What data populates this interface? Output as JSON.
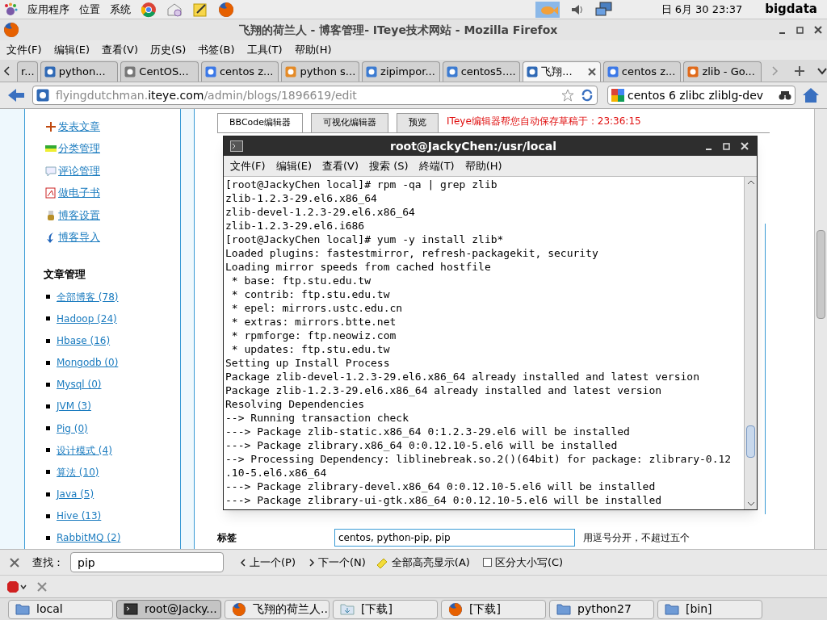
{
  "desktop_panel": {
    "menus": [
      "应用程序",
      "位置",
      "系统"
    ],
    "clock": "日 6月 30 23:37",
    "user": "bigdata"
  },
  "browser": {
    "title": "飞翔的荷兰人 - 博客管理- ITeye技术网站 - Mozilla Firefox",
    "menu": [
      "文件(F)",
      "编辑(E)",
      "查看(V)",
      "历史(S)",
      "书签(B)",
      "工具(T)",
      "帮助(H)"
    ],
    "tabs": [
      {
        "label": "r...",
        "selected": false
      },
      {
        "label": "python...",
        "selected": false
      },
      {
        "label": "CentOS...",
        "selected": false
      },
      {
        "label": "centos z...",
        "selected": false
      },
      {
        "label": "python s...",
        "selected": false
      },
      {
        "label": "zipimpor...",
        "selected": false
      },
      {
        "label": "centos5....",
        "selected": false
      },
      {
        "label": "飞翔...",
        "selected": true
      },
      {
        "label": "centos z...",
        "selected": false
      },
      {
        "label": "zlib - Go...",
        "selected": false
      }
    ],
    "url": {
      "prefix": "flyingdutchman.",
      "host": "iteye.com",
      "path": "/admin/blogs/1896619/edit"
    },
    "search": "centos 6 zlibc zliblg-dev"
  },
  "sidebar": {
    "actions": [
      {
        "label": "发表文章",
        "kind": "plus"
      },
      {
        "label": "分类管理",
        "kind": "bars"
      },
      {
        "label": "评论管理",
        "kind": "comment"
      },
      {
        "label": "做电子书",
        "kind": "pdf"
      },
      {
        "label": "博客设置",
        "kind": "key"
      },
      {
        "label": "博客导入",
        "kind": "import"
      }
    ],
    "heading": "文章管理",
    "categories": [
      "全部博客 (78)",
      "Hadoop (24)",
      "Hbase (16)",
      "Mongodb (0)",
      "Mysql (0)",
      "JVM (3)",
      "Pig (0)",
      "设计模式 (4)",
      "算法 (10)",
      "Java (5)",
      "Hive (13)",
      "RabbitMQ (2)"
    ]
  },
  "editor": {
    "tabs": [
      {
        "label": "BBCode编辑器",
        "selected": true
      },
      {
        "label": "可视化编辑器",
        "selected": false
      },
      {
        "label": "预览",
        "selected": false
      }
    ],
    "autosave": "ITeye编辑器帮您自动保存草稿于：23:36:15",
    "tags_label": "标签",
    "tags_value": "centos, python-pip, pip",
    "tags_hint": "用逗号分开，不超过五个"
  },
  "terminal": {
    "title": "root@JackyChen:/usr/local",
    "menu": [
      "文件(F)",
      "编辑(E)",
      "查看(V)",
      "搜索 (S)",
      "終端(T)",
      "帮助(H)"
    ],
    "lines": [
      "[root@JackyChen local]# rpm -qa | grep zlib",
      "zlib-1.2.3-29.el6.x86_64",
      "zlib-devel-1.2.3-29.el6.x86_64",
      "zlib-1.2.3-29.el6.i686",
      "[root@JackyChen local]# yum -y install zlib*",
      "Loaded plugins: fastestmirror, refresh-packagekit, security",
      "Loading mirror speeds from cached hostfile",
      " * base: ftp.stu.edu.tw",
      " * contrib: ftp.stu.edu.tw",
      " * epel: mirrors.ustc.edu.cn",
      " * extras: mirrors.btte.net",
      " * rpmforge: ftp.neowiz.com",
      " * updates: ftp.stu.edu.tw",
      "Setting up Install Process",
      "Package zlib-devel-1.2.3-29.el6.x86_64 already installed and latest version",
      "Package zlib-1.2.3-29.el6.x86_64 already installed and latest version",
      "Resolving Dependencies",
      "--> Running transaction check",
      "---> Package zlib-static.x86_64 0:1.2.3-29.el6 will be installed",
      "---> Package zlibrary.x86_64 0:0.12.10-5.el6 will be installed",
      "--> Processing Dependency: liblinebreak.so.2()(64bit) for package: zlibrary-0.12",
      ".10-5.el6.x86_64",
      "---> Package zlibrary-devel.x86_64 0:0.12.10-5.el6 will be installed",
      "---> Package zlibrary-ui-gtk.x86_64 0:0.12.10-5.el6 will be installed"
    ]
  },
  "find_bar": {
    "label": "查找：",
    "value": "pip",
    "prev": "上一个(P)",
    "next": "下一个(N)",
    "highlight": "全部高亮显示(A)",
    "match_case": {
      "label": "区分大小写(C)",
      "checked": false
    }
  },
  "taskbar": [
    {
      "label": "local",
      "kind": "folder",
      "selected": false
    },
    {
      "label": "root@Jacky...",
      "kind": "terminal",
      "selected": true
    },
    {
      "label": "飞翔的荷兰人...",
      "kind": "firefox",
      "selected": false
    },
    {
      "label": "[下载]",
      "kind": "download",
      "selected": false
    },
    {
      "label": "[下载]",
      "kind": "firefox",
      "selected": false
    },
    {
      "label": "python27",
      "kind": "folder",
      "selected": false
    },
    {
      "label": "[bin]",
      "kind": "folder",
      "selected": false
    }
  ]
}
